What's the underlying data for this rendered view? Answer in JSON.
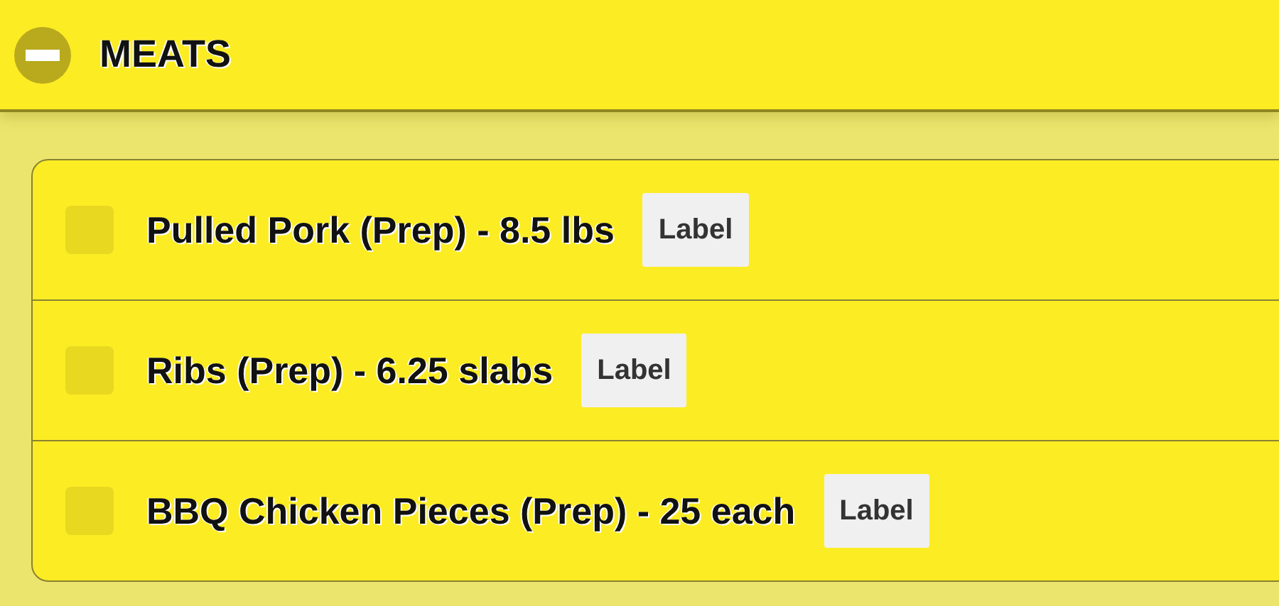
{
  "section": {
    "title": "MEATS",
    "expanded": true
  },
  "items": [
    {
      "text": "Pulled Pork (Prep) - 8.5 lbs",
      "button": "Label",
      "checked": false
    },
    {
      "text": "Ribs (Prep) - 6.25 slabs",
      "button": "Label",
      "checked": false
    },
    {
      "text": "BBQ Chicken Pieces (Prep) - 25 each",
      "button": "Label",
      "checked": false
    }
  ]
}
